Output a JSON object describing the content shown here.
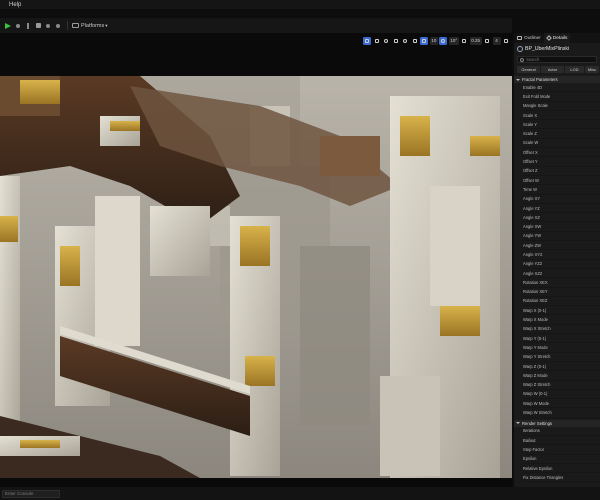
{
  "menu": {
    "items": [
      "",
      "Help"
    ]
  },
  "toolbar": {
    "platforms_label": "Platforms"
  },
  "viewport": {
    "buttons": [
      "",
      "",
      "",
      "",
      "",
      "",
      "10",
      "",
      "10°",
      "",
      "0.25",
      "",
      "4",
      ""
    ]
  },
  "status": {
    "cmd_placeholder": "Enter Console"
  },
  "panel": {
    "tabs": {
      "outliner": "Outliner",
      "details": "Details"
    },
    "actor_name": "BP_UberMixPlinski",
    "search_placeholder": "Search",
    "filters": [
      "General",
      "Actor",
      "LOD",
      "Misc"
    ],
    "fractal_section": "Fractal Parameters",
    "fractal_props": [
      "Enable 4D",
      "Exit Fold Mode",
      "Mangle Scale",
      "Scale X",
      "Scale Y",
      "Scale Z",
      "Scale W",
      "Offset X",
      "Offset Y",
      "Offset Z",
      "Offset W",
      "Time W",
      "Angle XY",
      "Angle YZ",
      "Angle XZ",
      "Angle XW",
      "Angle YW",
      "Angle ZW",
      "Angle XY2",
      "Angle YZ2",
      "Angle XZ2",
      "Rotation XEX",
      "Rotation XEY",
      "Rotation XEZ",
      "Warp X (0-1)",
      "Warp X Mode",
      "Warp X Stretch",
      "Warp Y (0-1)",
      "Warp Y Mode",
      "Warp Y Stretch",
      "Warp Z (0-1)",
      "Warp Z Mode",
      "Warp Z Stretch",
      "Warp W (0-1)",
      "Warp W Mode",
      "Warp W Stretch"
    ],
    "render_section": "Render Settings",
    "render_props": [
      "Iterations",
      "Bailout",
      "Step Factor",
      "Epsilon",
      "Relative Epsilon",
      "Fix Distance Triangles"
    ]
  }
}
